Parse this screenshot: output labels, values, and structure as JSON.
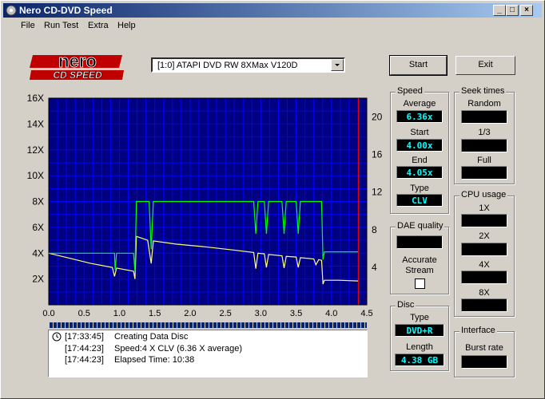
{
  "window": {
    "title": "Nero CD-DVD Speed"
  },
  "menu": [
    {
      "label": "File"
    },
    {
      "label": "Run Test"
    },
    {
      "label": "Extra"
    },
    {
      "label": "Help"
    }
  ],
  "logo": {
    "line1": "nero",
    "line2": "CD SPEED"
  },
  "drive": {
    "selected": "[1:0]  ATAPI DVD RW 8XMax V120D"
  },
  "buttons": {
    "start": "Start",
    "exit": "Exit"
  },
  "chart_data": {
    "type": "line",
    "x_ticks": [
      "0.0",
      "0.5",
      "1.0",
      "1.5",
      "2.0",
      "2.5",
      "3.0",
      "3.5",
      "4.0",
      "4.5"
    ],
    "y_left_ticks": [
      "2X",
      "4X",
      "6X",
      "8X",
      "10X",
      "12X",
      "14X",
      "16X"
    ],
    "y_right_ticks": [
      "4",
      "8",
      "12",
      "16",
      "20"
    ],
    "xlim": [
      0,
      4.5
    ],
    "ylim_left": [
      0,
      16
    ],
    "ylim_right": [
      0,
      22
    ],
    "grid": true,
    "marker_x": 4.38,
    "colors": {
      "background": "#000080",
      "grid": "#0000ff",
      "speed": "#ffff80",
      "rpm": "#00ff00",
      "marker": "#ff0000"
    },
    "series": [
      {
        "color": "#ffff80",
        "points": [
          [
            0,
            4.0
          ],
          [
            0.3,
            3.6
          ],
          [
            0.6,
            3.2
          ],
          [
            0.9,
            2.9
          ],
          [
            0.93,
            2.2
          ],
          [
            0.96,
            2.85
          ],
          [
            1.2,
            2.6
          ],
          [
            1.22,
            2.0
          ],
          [
            1.24,
            5.3
          ],
          [
            1.4,
            5.0
          ],
          [
            1.45,
            3.2
          ],
          [
            1.48,
            4.95
          ],
          [
            1.8,
            4.7
          ],
          [
            2.2,
            4.5
          ],
          [
            2.6,
            4.25
          ],
          [
            2.9,
            4.05
          ],
          [
            2.93,
            2.8
          ],
          [
            2.96,
            4.0
          ],
          [
            3.05,
            3.95
          ],
          [
            3.08,
            2.9
          ],
          [
            3.11,
            3.9
          ],
          [
            3.3,
            3.8
          ],
          [
            3.33,
            2.85
          ],
          [
            3.36,
            3.75
          ],
          [
            3.5,
            3.7
          ],
          [
            3.53,
            2.9
          ],
          [
            3.56,
            3.65
          ],
          [
            3.75,
            3.55
          ],
          [
            3.78,
            3.1
          ],
          [
            3.82,
            3.5
          ],
          [
            3.86,
            3.45
          ],
          [
            3.88,
            1.6
          ],
          [
            3.9,
            1.9
          ],
          [
            4.1,
            1.9
          ],
          [
            4.38,
            1.85
          ]
        ]
      },
      {
        "color": "#00ff00",
        "points": [
          [
            0,
            4.0
          ],
          [
            0.3,
            4.0
          ],
          [
            0.6,
            4.0
          ],
          [
            0.93,
            4.0
          ],
          [
            0.94,
            2.7
          ],
          [
            0.96,
            4.0
          ],
          [
            1.2,
            4.0
          ],
          [
            1.22,
            2.6
          ],
          [
            1.24,
            8.0
          ],
          [
            1.42,
            8.0
          ],
          [
            1.45,
            4.3
          ],
          [
            1.48,
            8.0
          ],
          [
            1.8,
            8.0
          ],
          [
            2.2,
            8.0
          ],
          [
            2.6,
            8.0
          ],
          [
            2.9,
            8.0
          ],
          [
            2.93,
            5.5
          ],
          [
            2.96,
            8.0
          ],
          [
            3.05,
            8.0
          ],
          [
            3.08,
            5.5
          ],
          [
            3.11,
            8.0
          ],
          [
            3.3,
            8.0
          ],
          [
            3.33,
            5.5
          ],
          [
            3.36,
            8.0
          ],
          [
            3.5,
            8.0
          ],
          [
            3.53,
            5.5
          ],
          [
            3.56,
            8.0
          ],
          [
            3.86,
            8.0
          ],
          [
            3.88,
            3.5
          ],
          [
            3.9,
            4.1
          ],
          [
            4.1,
            4.1
          ],
          [
            4.38,
            4.1
          ]
        ]
      }
    ]
  },
  "speed": {
    "title": "Speed",
    "average_label": "Average",
    "average": "6.36x",
    "start_label": "Start",
    "start": "4.00x",
    "end_label": "End",
    "end": "4.05x",
    "type_label": "Type",
    "type": "CLV"
  },
  "seek": {
    "title": "Seek times",
    "random_label": "Random",
    "third_label": "1/3",
    "full_label": "Full"
  },
  "dae": {
    "title": "DAE quality",
    "accurate_label": "Accurate",
    "stream_label": "Stream"
  },
  "cpu": {
    "title": "CPU usage",
    "x1": "1X",
    "x2": "2X",
    "x4": "4X",
    "x8": "8X"
  },
  "disc": {
    "title": "Disc",
    "type_label": "Type",
    "type": "DVD+R",
    "length_label": "Length",
    "length": "4.38 GB"
  },
  "interface": {
    "title": "Interface",
    "burst_label": "Burst rate"
  },
  "log": [
    {
      "time": "[17:33:45]",
      "message": "Creating Data Disc"
    },
    {
      "time": "[17:44:23]",
      "message": "Speed:4 X CLV (6.36 X average)"
    },
    {
      "time": "[17:44:23]",
      "message": "Elapsed Time: 10:38"
    }
  ]
}
